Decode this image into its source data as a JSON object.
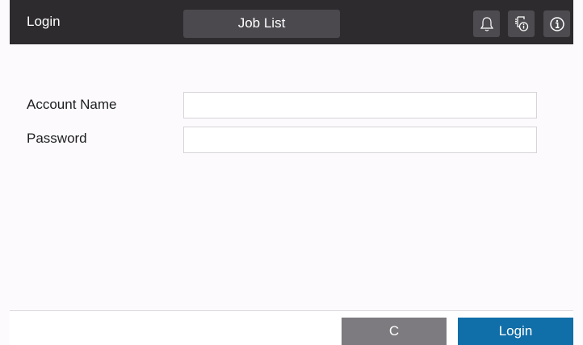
{
  "header": {
    "title": "Login",
    "job_list_label": "Job List",
    "icons": [
      "bell-icon",
      "device-info-icon",
      "info-icon"
    ]
  },
  "form": {
    "account_name_label": "Account Name",
    "account_name_value": "",
    "password_label": "Password",
    "password_value": ""
  },
  "footer": {
    "clear_label": "C",
    "login_label": "Login"
  },
  "colors": {
    "header_bg": "#2d2b2e",
    "login_button": "#106ea8",
    "clear_button": "#7d7b7f"
  }
}
